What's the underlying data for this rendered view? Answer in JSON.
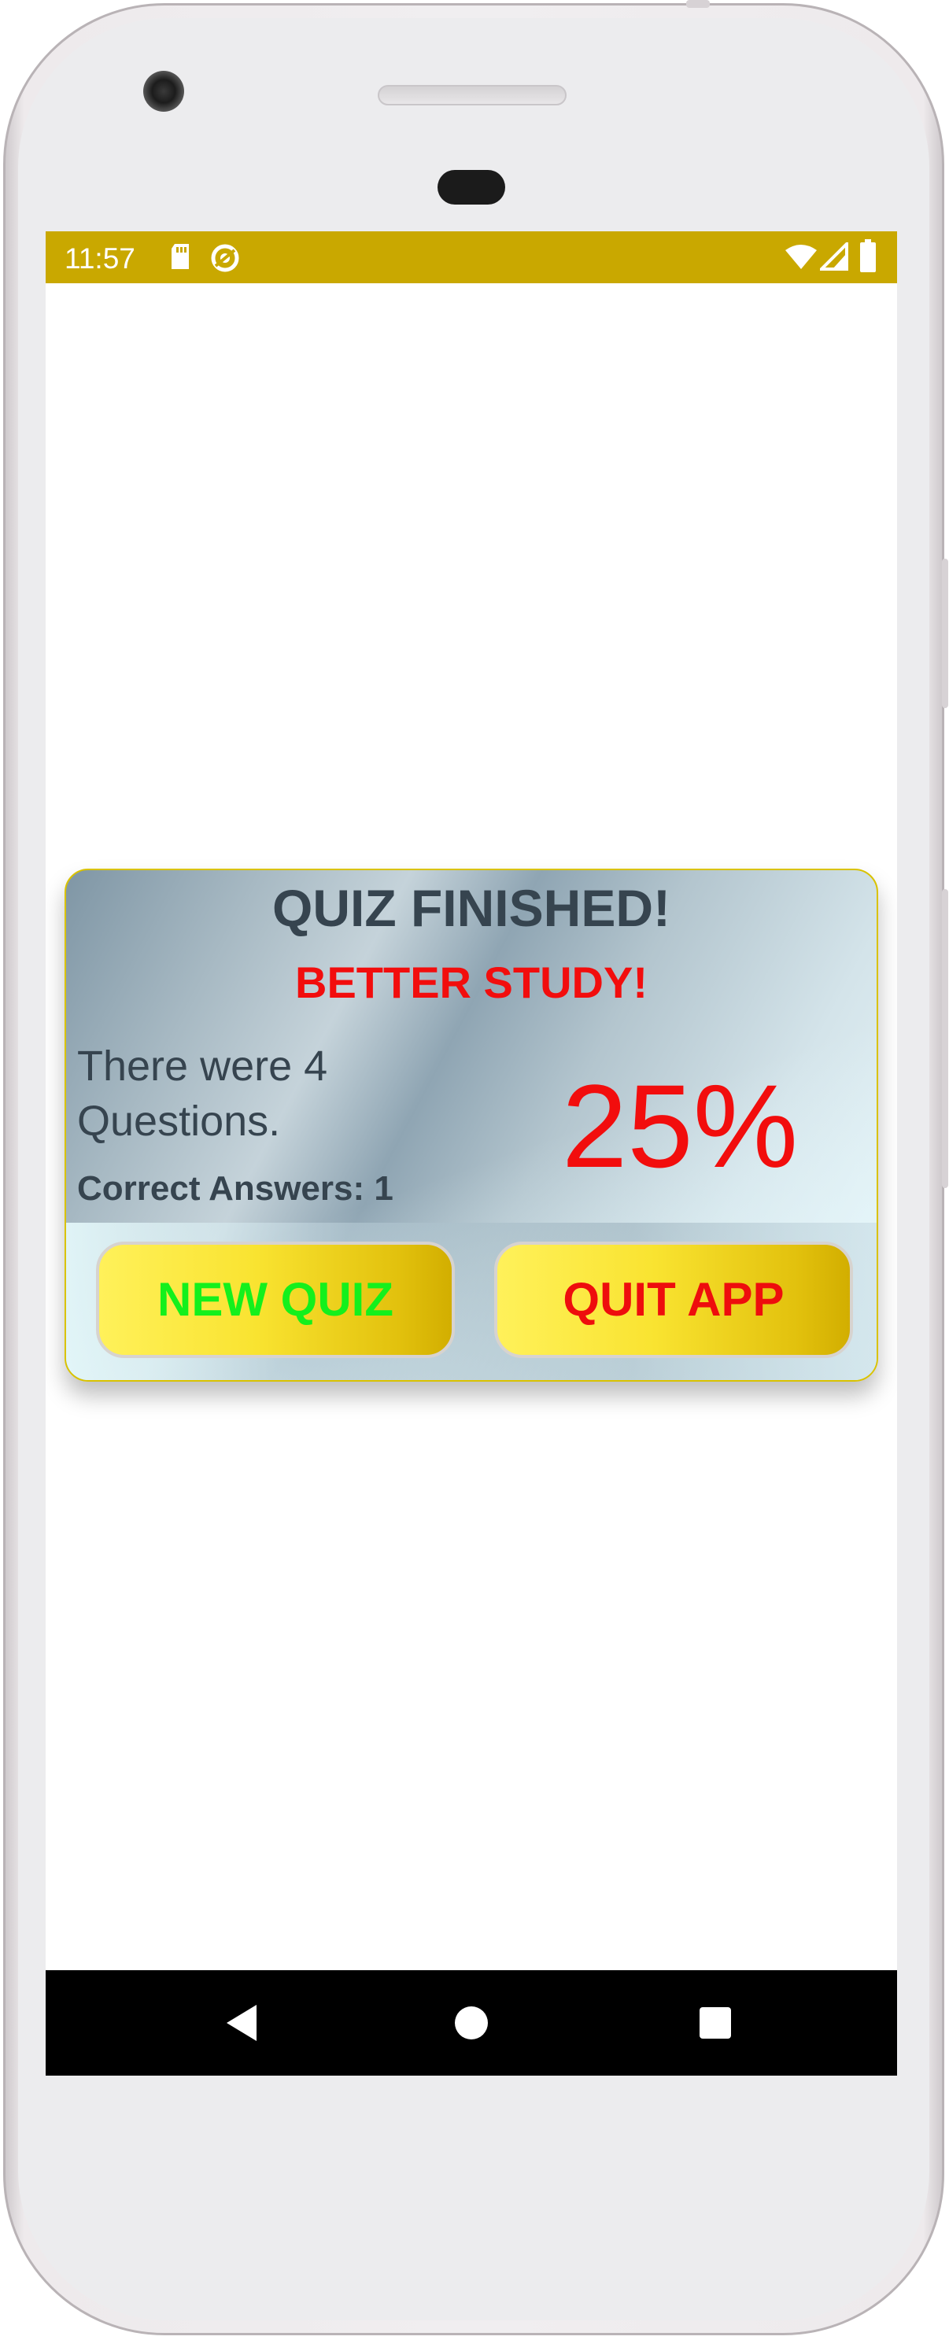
{
  "status_bar": {
    "time": "11:57",
    "background_color": "#c9a800",
    "left_icons": [
      "sd-card-icon",
      "sync-icon"
    ],
    "right_icons": [
      "wifi-icon",
      "cell-signal-icon",
      "battery-icon"
    ]
  },
  "dialog": {
    "title": "QUIZ FINISHED!",
    "subtitle": "BETTER STUDY!",
    "questions_text": "There were 4 Questions.",
    "correct_text": "Correct Answers: 1",
    "percent": "25%",
    "new_quiz_label": "NEW QUIZ",
    "quit_app_label": "QUIT APP",
    "colors": {
      "title": "#36444f",
      "warning": "#f20d0d",
      "new_quiz_text": "#14f01c",
      "button_gold": "#f9e330"
    }
  },
  "nav_bar": {
    "icons": [
      "back-icon",
      "home-icon",
      "recents-icon"
    ]
  }
}
